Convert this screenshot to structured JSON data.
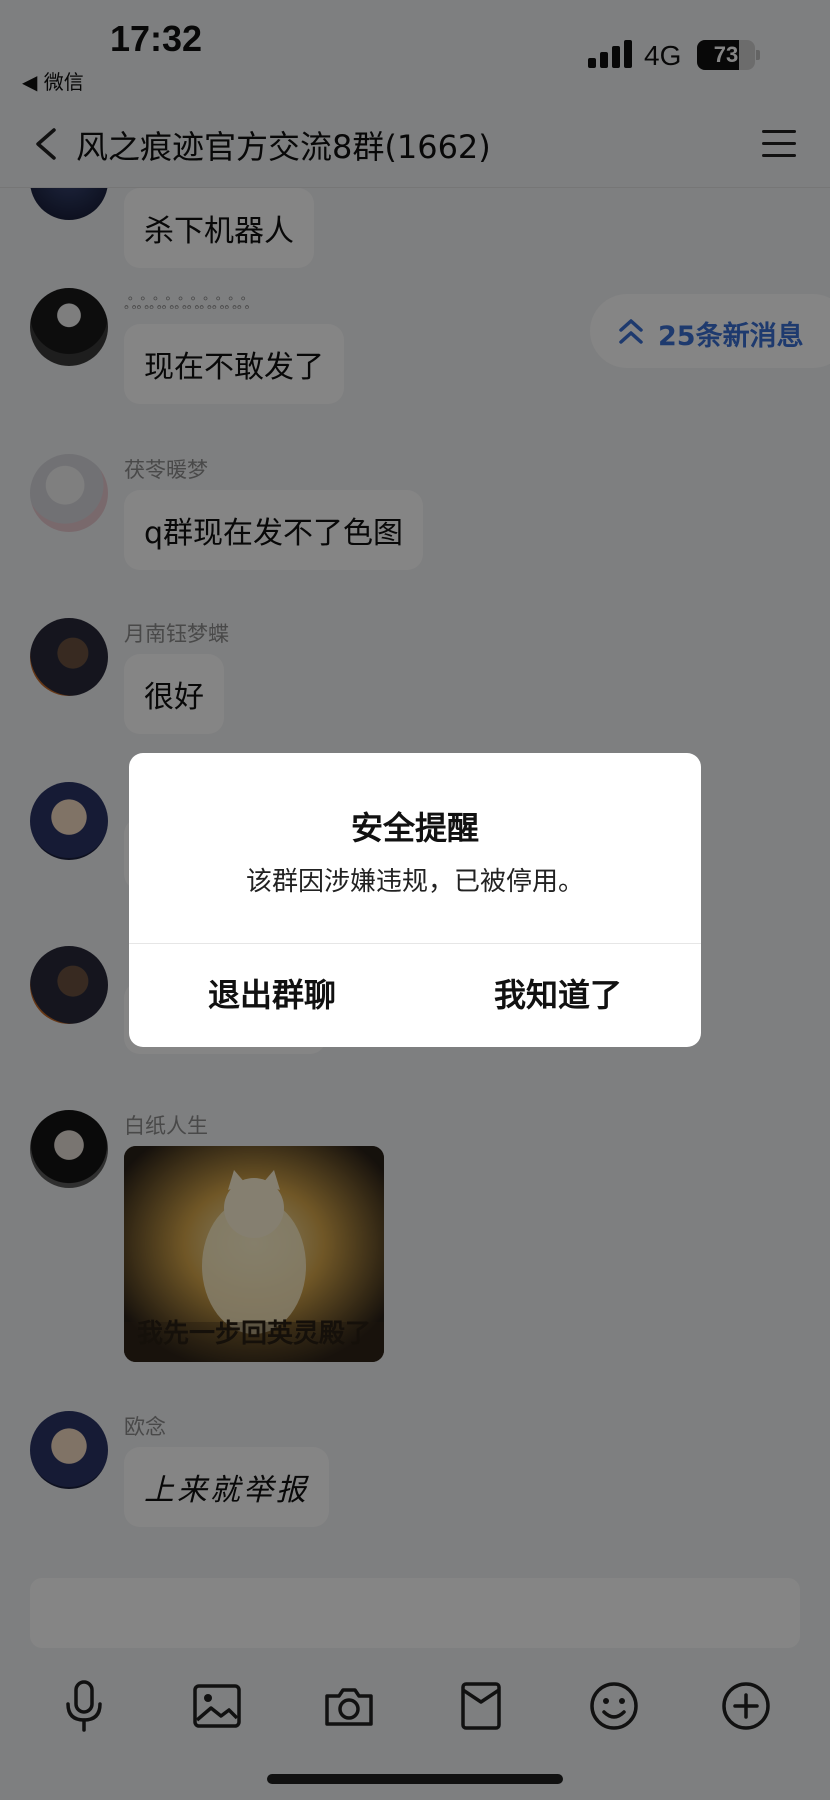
{
  "status_bar": {
    "time": "17:32",
    "back_app": "◀ 微信",
    "network": "4G",
    "battery_level": 73,
    "battery_text": "73"
  },
  "header": {
    "title": "风之痕迹官方交流8群(1662)",
    "back_icon": "chevron-left-icon",
    "menu_icon": "hamburger-menu-icon"
  },
  "new_messages": {
    "label": "25条新消息",
    "icon": "double-chevron-up-icon"
  },
  "messages": [
    {
      "sender": "",
      "text": "杀下机器人"
    },
    {
      "sender": "ஃஃஃஃஃஃஃஃஃஃ",
      "text": "现在不敢发了"
    },
    {
      "sender": "茯苓暖梦",
      "text": "q群现在发不了色图"
    },
    {
      "sender": "月南钰梦蝶",
      "text": "很好"
    },
    {
      "sender": "",
      "text": ""
    },
    {
      "sender": "",
      "text": ""
    },
    {
      "sender": "白纸人生",
      "image_caption": "我先一步回英灵殿了"
    },
    {
      "sender": "欧念",
      "text": "上来就举报"
    }
  ],
  "dialog": {
    "title": "安全提醒",
    "message": "该群因涉嫌违规，已被停用。",
    "exit_label": "退出群聊",
    "ok_label": "我知道了"
  },
  "toolbar": {
    "icons": [
      "microphone-icon",
      "image-icon",
      "camera-icon",
      "red-packet-icon",
      "emoji-icon",
      "plus-circle-icon"
    ]
  },
  "colors": {
    "accent": "#3a6fd4",
    "background": "#f2f3f5",
    "overlay": "rgba(0,0,0,0.48)"
  }
}
